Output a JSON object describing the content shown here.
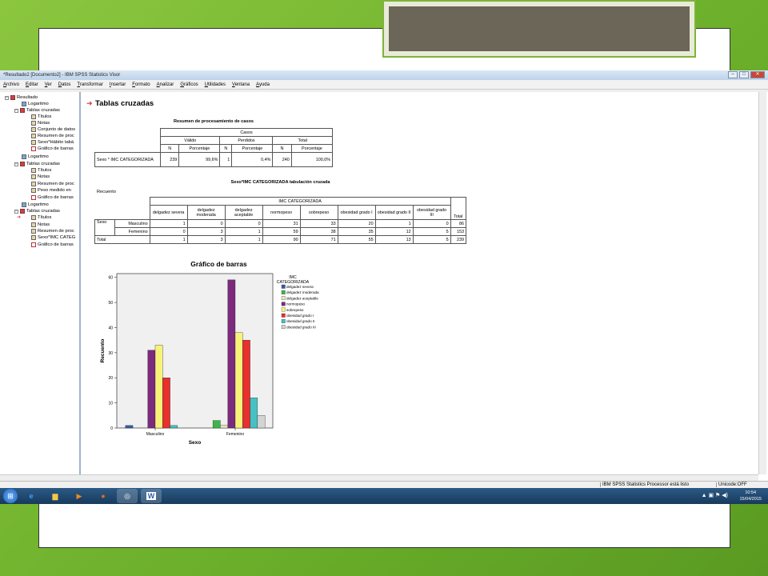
{
  "window": {
    "title": "*Resultado2 [Documento2] - IBM SPSS Statistics Visor",
    "controls": [
      "–",
      "□",
      "✕"
    ]
  },
  "menu": [
    "Archivo",
    "Editar",
    "Ver",
    "Datos",
    "Transformar",
    "Insertar",
    "Formato",
    "Analizar",
    "Gráficos",
    "Utilidades",
    "Ventana",
    "Ayuda"
  ],
  "tree": [
    {
      "label": "Resultado",
      "icon": "book-icon"
    },
    {
      "label": "Logaritmo",
      "icon": "log-icon"
    },
    {
      "label": "Tablas cruzadas",
      "icon": "book-icon"
    },
    {
      "label": "Títulos",
      "icon": "table-icon"
    },
    {
      "label": "Notas",
      "icon": "table-icon"
    },
    {
      "label": "Conjunto de datos",
      "icon": "table-icon"
    },
    {
      "label": "Resumen de proc",
      "icon": "table-icon"
    },
    {
      "label": "Sexo*Hábito tabá",
      "icon": "table-icon"
    },
    {
      "label": "Gráfico de barras",
      "icon": "chart-icon"
    },
    {
      "label": "Logaritmo",
      "icon": "log-icon"
    },
    {
      "label": "Tablas cruzadas",
      "icon": "book-icon"
    },
    {
      "label": "Títulos",
      "icon": "table-icon"
    },
    {
      "label": "Notas",
      "icon": "table-icon"
    },
    {
      "label": "Resumen de proc",
      "icon": "table-icon"
    },
    {
      "label": "Peso medido en",
      "icon": "table-icon"
    },
    {
      "label": "Gráfico de barras",
      "icon": "chart-icon"
    },
    {
      "label": "Logaritmo",
      "icon": "log-icon"
    },
    {
      "label": "Tablas cruzadas",
      "icon": "book-icon"
    },
    {
      "label": "Títulos",
      "icon": "table-icon"
    },
    {
      "label": "Notas",
      "icon": "table-icon"
    },
    {
      "label": "Resumen de proc",
      "icon": "table-icon"
    },
    {
      "label": "Sexo*IMC CATEG",
      "icon": "table-icon"
    },
    {
      "label": "Gráfico de barras",
      "icon": "chart-icon"
    }
  ],
  "output": {
    "heading": "Tablas cruzadas",
    "summary": {
      "title": "Resumen de procesamiento de casos",
      "casos": "Casos",
      "groups": [
        "Válido",
        "Perdidos",
        "Total"
      ],
      "cols": [
        "N",
        "Porcentaje",
        "N",
        "Porcentaje",
        "N",
        "Porcentaje"
      ],
      "row_label": "Sexo * IMC CATEGORIZADA",
      "values": [
        "239",
        "99,6%",
        "1",
        "0,4%",
        "240",
        "100,0%"
      ]
    },
    "crosstab": {
      "title": "Sexo*IMC CATEGORIZADA tabulación cruzada",
      "count_label": "Recuento",
      "group_header": "IMC CATEGORIZADA",
      "cols": [
        "delgadez severa",
        "delgadez moderada",
        "delgadez aceptable",
        "normopeso",
        "sobrepeso",
        "obesidad grado I",
        "obesidad grado II",
        "obesidad grado III"
      ],
      "total_label": "Total",
      "sexo_label": "Sexo",
      "rows": [
        {
          "label": "Masculino",
          "values": [
            "1",
            "0",
            "0",
            "31",
            "33",
            "20",
            "1",
            "0",
            "86"
          ]
        },
        {
          "label": "Femenino",
          "values": [
            "0",
            "3",
            "1",
            "59",
            "38",
            "35",
            "12",
            "5",
            "153"
          ]
        }
      ],
      "total_row": {
        "label": "Total",
        "values": [
          "1",
          "3",
          "1",
          "90",
          "71",
          "55",
          "13",
          "5",
          "239"
        ]
      }
    }
  },
  "chart_data": {
    "type": "bar",
    "title": "Gráfico de barras",
    "xlabel": "Sexo",
    "ylabel": "Recuento",
    "ylim": [
      0,
      60
    ],
    "yticks": [
      0,
      10,
      20,
      30,
      40,
      50,
      60
    ],
    "categories": [
      "Masculino",
      "Femenino"
    ],
    "legend_title": "IMC CATEGORIZADA",
    "legend_placement": "right",
    "series": [
      {
        "name": "delgadez severa",
        "color": "#3a58a8",
        "values": [
          1,
          0
        ]
      },
      {
        "name": "delgadez moderada",
        "color": "#3cb64b",
        "values": [
          0,
          3
        ]
      },
      {
        "name": "delgadez aceptable",
        "color": "#e8e8b8",
        "values": [
          0,
          1
        ]
      },
      {
        "name": "normopeso",
        "color": "#7b2a7d",
        "values": [
          31,
          59
        ]
      },
      {
        "name": "sobrepeso",
        "color": "#f8f27a",
        "values": [
          33,
          38
        ]
      },
      {
        "name": "obesidad grado I",
        "color": "#e8302f",
        "values": [
          20,
          35
        ]
      },
      {
        "name": "obesidad grado II",
        "color": "#45c1c4",
        "values": [
          1,
          12
        ]
      },
      {
        "name": "obesidad grado III",
        "color": "#d3d3d3",
        "values": [
          0,
          5
        ]
      }
    ]
  },
  "status": {
    "processor": "IBM SPSS Statistics Processor está listo",
    "unicode": "Unicode:OFF"
  },
  "taskbar": {
    "time": "10:54",
    "date": "15/04/2015"
  }
}
